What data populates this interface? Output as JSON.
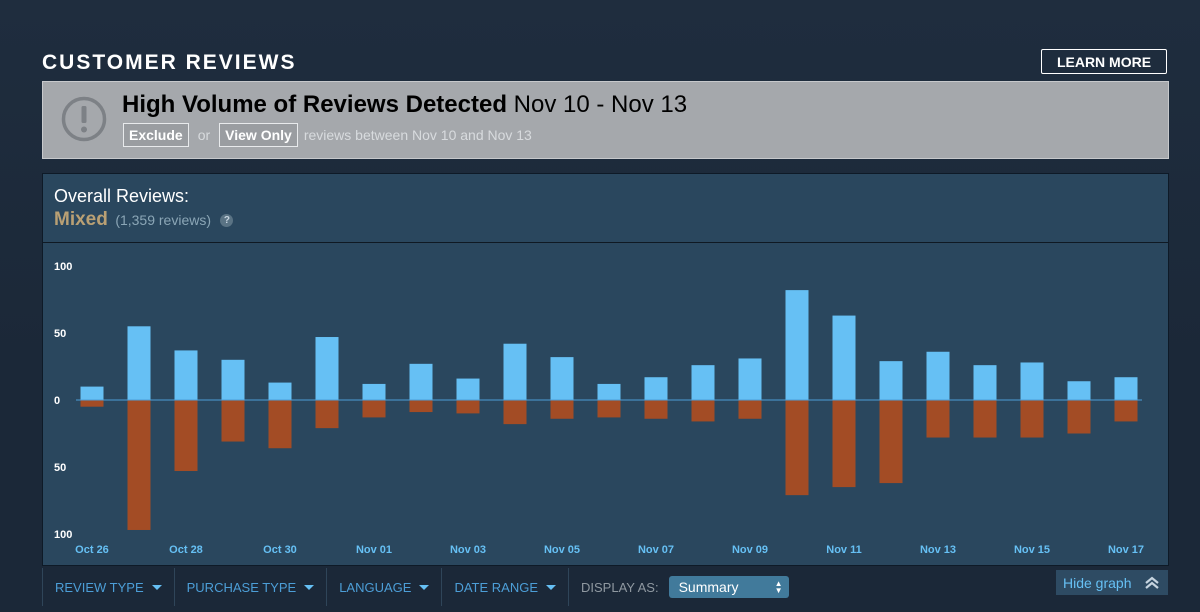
{
  "section": {
    "title": "CUSTOMER REVIEWS",
    "learn_more": "LEARN MORE"
  },
  "alert": {
    "title_bold": "High Volume of Reviews Detected",
    "title_range": "Nov 10 - Nov 13",
    "exclude_label": "Exclude",
    "or_text": "or",
    "view_only_label": "View Only",
    "description": "reviews between Nov 10 and Nov 13"
  },
  "overall": {
    "label": "Overall Reviews:",
    "rating": "Mixed",
    "count": "(1,359 reviews)",
    "help": "?"
  },
  "chart_data": {
    "type": "bar",
    "categories": [
      "Oct 26",
      "Oct 27",
      "Oct 28",
      "Oct 29",
      "Oct 30",
      "Oct 31",
      "Nov 01",
      "Nov 02",
      "Nov 03",
      "Nov 04",
      "Nov 05",
      "Nov 06",
      "Nov 07",
      "Nov 08",
      "Nov 09",
      "Nov 10",
      "Nov 11",
      "Nov 12",
      "Nov 13",
      "Nov 14",
      "Nov 15",
      "Nov 16",
      "Nov 17"
    ],
    "x_tick_labels": [
      "Oct 26",
      "Oct 28",
      "Oct 30",
      "Nov 01",
      "Nov 03",
      "Nov 05",
      "Nov 07",
      "Nov 09",
      "Nov 11",
      "Nov 13",
      "Nov 15",
      "Nov 17"
    ],
    "series": [
      {
        "values": [
          10,
          55,
          37,
          30,
          13,
          47,
          12,
          27,
          16,
          42,
          32,
          12,
          17,
          26,
          31,
          82,
          63,
          29,
          36,
          26,
          28,
          14,
          17
        ],
        "color": "#66c0f4"
      },
      {
        "values": [
          -5,
          -97,
          -53,
          -31,
          -36,
          -21,
          -13,
          -9,
          -10,
          -18,
          -14,
          -13,
          -14,
          -16,
          -14,
          -71,
          -65,
          -62,
          -28,
          -28,
          -28,
          -25,
          -16
        ],
        "color": "#a34c25"
      }
    ],
    "y_tick_labels": [
      "100",
      "50",
      "0",
      "50",
      "100"
    ],
    "ylim": [
      -100,
      100
    ],
    "zero_line_color": "#4c9ed7"
  },
  "filters": [
    {
      "label": "REVIEW TYPE"
    },
    {
      "label": "PURCHASE TYPE"
    },
    {
      "label": "LANGUAGE"
    },
    {
      "label": "DATE RANGE"
    }
  ],
  "display_as": {
    "label": "DISPLAY AS:",
    "value": "Summary"
  },
  "hide_graph": {
    "label": "Hide graph",
    "icon": "double-chevron-up-icon"
  }
}
